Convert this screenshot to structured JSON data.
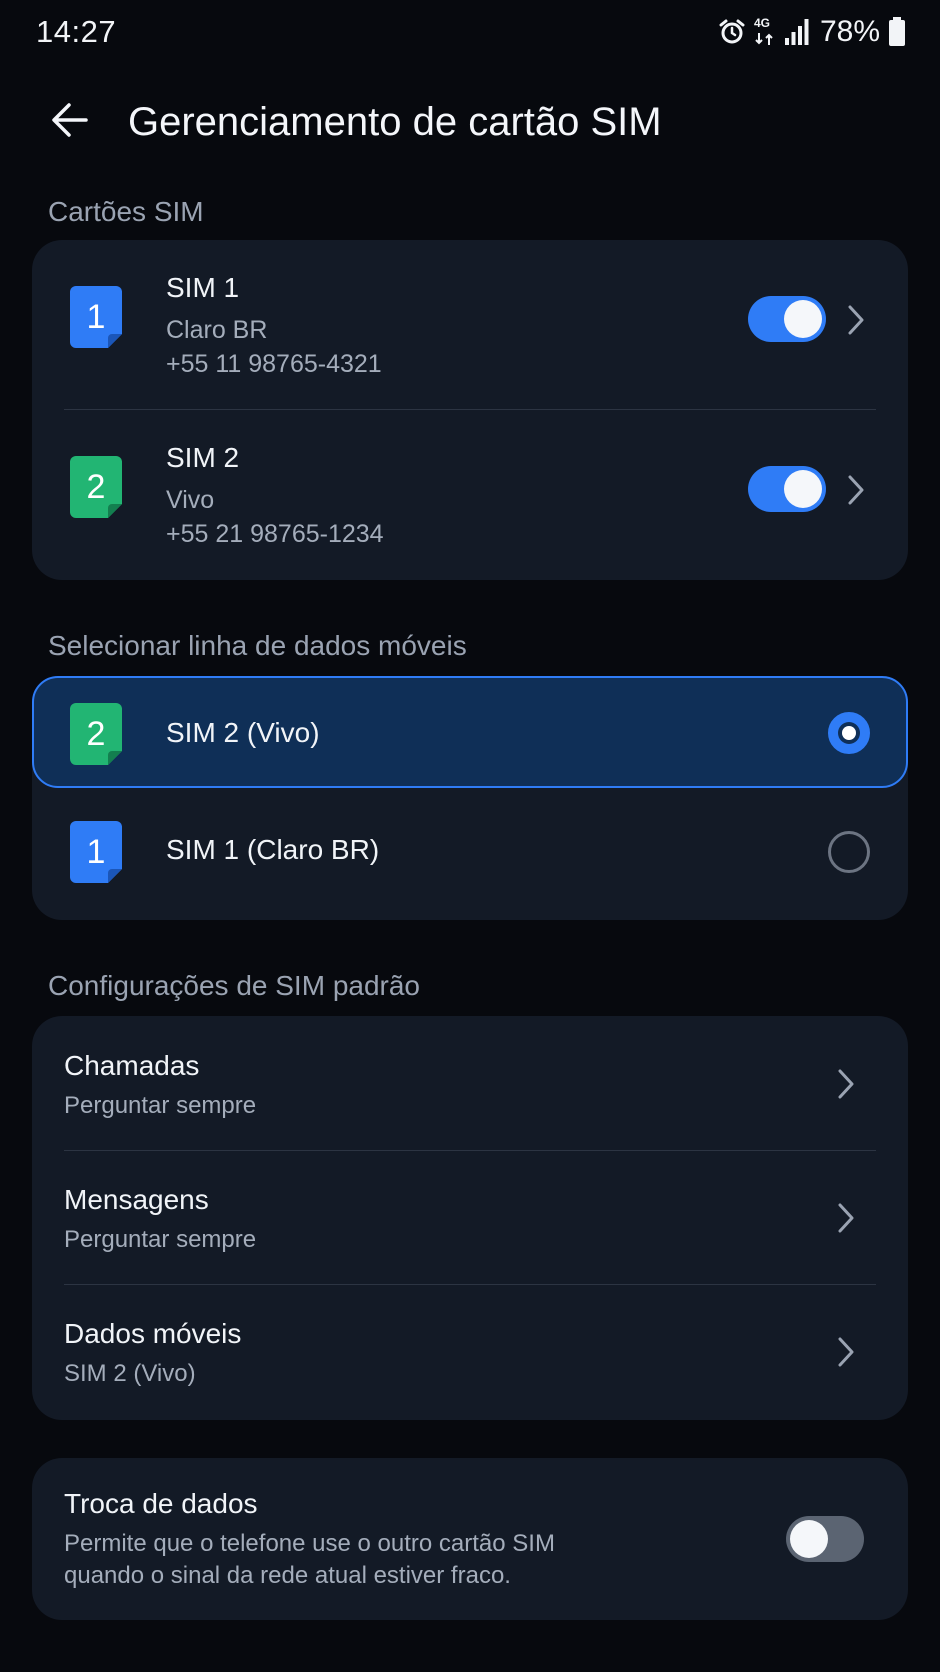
{
  "status_bar": {
    "time": "14:27",
    "network": "4G",
    "battery": "78%",
    "icons": [
      "alarm-icon",
      "network-4g-icon",
      "signal-icon",
      "battery-icon"
    ]
  },
  "header": {
    "title": "Gerenciamento de cartão SIM",
    "back_icon": "arrow-left-icon"
  },
  "sim_cards": {
    "section_label": "Cartões SIM",
    "items": [
      {
        "slot": "1",
        "name": "SIM 1",
        "carrier": "Claro BR",
        "number": "+55 11 98765-4321",
        "enabled": true,
        "color": "#2f7cf6"
      },
      {
        "slot": "2",
        "name": "SIM 2",
        "carrier": "Vivo",
        "number": "+55 21 98765-1234",
        "enabled": true,
        "color": "#22b573"
      }
    ]
  },
  "data_line": {
    "section_label": "Selecionar linha de dados móveis",
    "options": [
      {
        "slot": "2",
        "label": "SIM 2 (Vivo)",
        "selected": true,
        "color": "#22b573"
      },
      {
        "slot": "1",
        "label": "SIM 1 (Claro BR)",
        "selected": false,
        "color": "#2f7cf6"
      }
    ]
  },
  "defaults": {
    "section_label": "Configurações de SIM padrão",
    "items": [
      {
        "title": "Chamadas",
        "value": "Perguntar sempre"
      },
      {
        "title": "Mensagens",
        "value": "Perguntar sempre"
      },
      {
        "title": "Dados móveis",
        "value": "SIM 2 (Vivo)"
      }
    ]
  },
  "data_swap": {
    "title": "Troca de dados",
    "description": "Permite que o telefone use o outro cartão SIM quando o sinal da rede atual estiver fraco.",
    "enabled": false
  },
  "colors": {
    "accent": "#2f7cf6",
    "sim1": "#2f7cf6",
    "sim2": "#22b573",
    "card_bg": "#131a26",
    "page_bg": "#07090e"
  }
}
